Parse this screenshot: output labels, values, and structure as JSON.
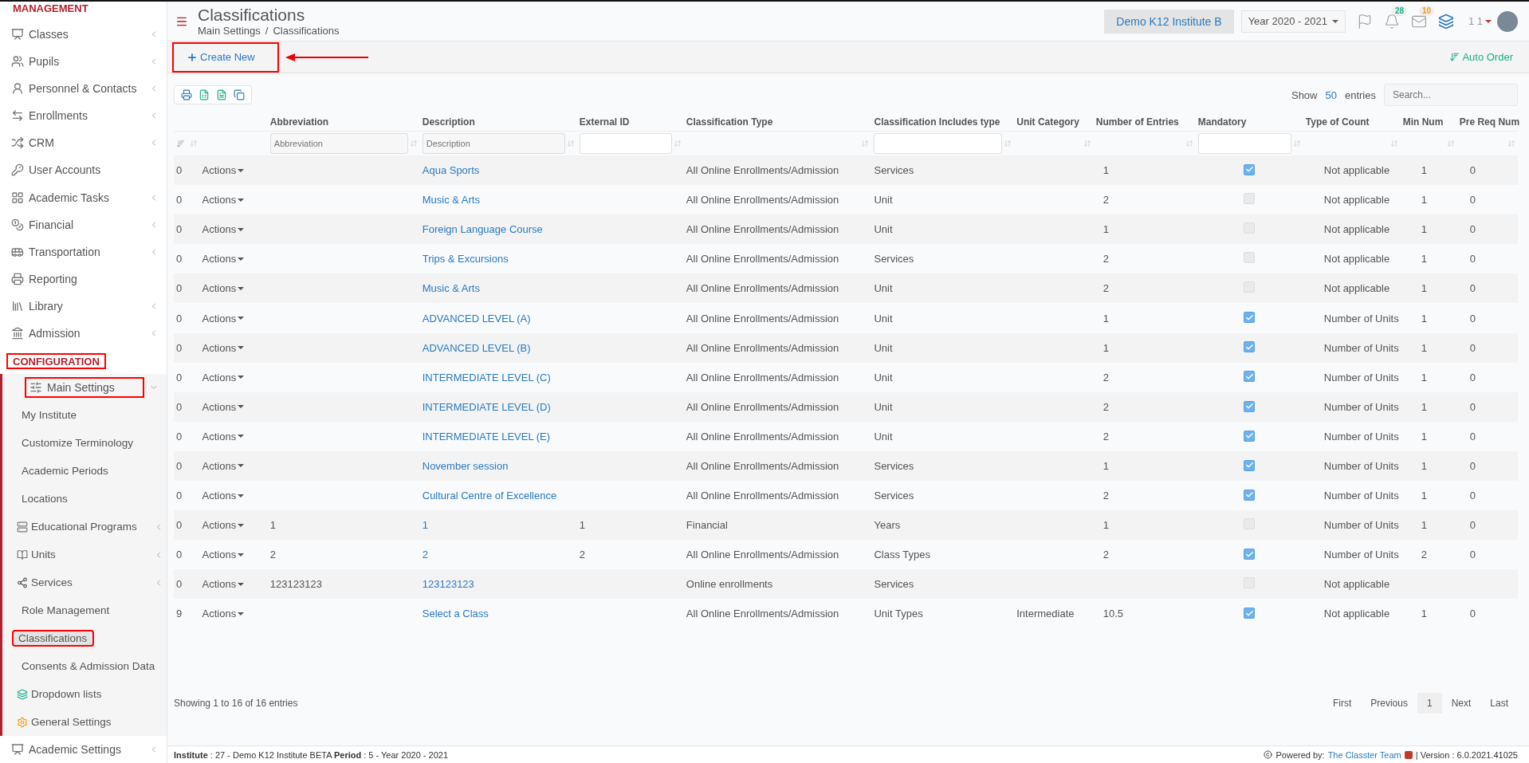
{
  "sidebar": {
    "sections": [
      {
        "title": "MANAGEMENT",
        "highlighted": false,
        "items": [
          {
            "label": "Classes",
            "collapsible": true,
            "expanded": false,
            "highlighted": false
          },
          {
            "label": "Pupils",
            "collapsible": true,
            "expanded": false,
            "highlighted": false
          },
          {
            "label": "Personnel & Contacts",
            "collapsible": true,
            "expanded": false,
            "highlighted": false
          },
          {
            "label": "Enrollments",
            "collapsible": true,
            "expanded": false,
            "highlighted": false
          },
          {
            "label": "CRM",
            "collapsible": true,
            "expanded": false,
            "highlighted": false
          },
          {
            "label": "User Accounts",
            "collapsible": false,
            "expanded": false,
            "highlighted": false
          },
          {
            "label": "Academic Tasks",
            "collapsible": true,
            "expanded": false,
            "highlighted": false
          },
          {
            "label": "Financial",
            "collapsible": true,
            "expanded": false,
            "highlighted": false
          },
          {
            "label": "Transportation",
            "collapsible": true,
            "expanded": false,
            "highlighted": false
          },
          {
            "label": "Reporting",
            "collapsible": false,
            "expanded": false,
            "highlighted": false
          },
          {
            "label": "Library",
            "collapsible": true,
            "expanded": false,
            "highlighted": false
          },
          {
            "label": "Admission",
            "collapsible": true,
            "expanded": false,
            "highlighted": false
          }
        ]
      },
      {
        "title": "CONFIGURATION",
        "highlighted": true,
        "items": [
          {
            "label": "Main Settings",
            "collapsible": true,
            "expanded": true,
            "highlighted": true,
            "children": [
              {
                "label": "My Institute",
                "collapsible": false,
                "selected": false,
                "highlighted": false
              },
              {
                "label": "Customize Terminology",
                "collapsible": false,
                "selected": false,
                "highlighted": false
              },
              {
                "label": "Academic Periods",
                "collapsible": false,
                "selected": false,
                "highlighted": false
              },
              {
                "label": "Locations",
                "collapsible": false,
                "selected": false,
                "highlighted": false
              },
              {
                "label": "Educational Programs",
                "collapsible": true,
                "selected": false,
                "highlighted": false
              },
              {
                "label": "Units",
                "collapsible": true,
                "selected": false,
                "highlighted": false
              },
              {
                "label": "Services",
                "collapsible": true,
                "selected": false,
                "highlighted": false
              },
              {
                "label": "Role Management",
                "collapsible": false,
                "selected": false,
                "highlighted": false
              },
              {
                "label": "Classifications",
                "collapsible": false,
                "selected": true,
                "highlighted": true
              },
              {
                "label": "Consents & Admission Data",
                "collapsible": false,
                "selected": false,
                "highlighted": false
              },
              {
                "label": "Dropdown lists",
                "collapsible": false,
                "selected": false,
                "highlighted": false
              },
              {
                "label": "General Settings",
                "collapsible": false,
                "selected": false,
                "highlighted": false
              }
            ]
          },
          {
            "label": "Academic Settings",
            "collapsible": true,
            "expanded": false,
            "highlighted": false
          }
        ]
      }
    ]
  },
  "header": {
    "title": "Classifications",
    "breadcrumb": [
      "Main Settings",
      "Classifications"
    ],
    "breadcrumb_separator": "/",
    "institute": "Demo K12 Institute B",
    "year": "Year 2020 - 2021",
    "notifications": "28",
    "messages": "10",
    "user": "1 1"
  },
  "toolbar": {
    "create_button": "Create New",
    "create_highlighted": true,
    "auto_order": "Auto Order"
  },
  "table_tools": {
    "show_label": "Show",
    "page_size": "50",
    "entries_label": "entries",
    "search_placeholder": "Search..."
  },
  "table": {
    "columns": [
      {
        "kind": "plain"
      },
      {
        "kind": "plain"
      },
      {
        "label": "Abbreviation",
        "kind": "textfilter",
        "placeholder": "Abbreviation"
      },
      {
        "label": "Description",
        "kind": "textfilter",
        "placeholder": "Description"
      },
      {
        "label": "External ID",
        "kind": "boxfilter"
      },
      {
        "label": "Classification Type",
        "kind": "plain"
      },
      {
        "label": "Classification Includes type",
        "kind": "boxfilter"
      },
      {
        "label": "Unit Category",
        "kind": "plain"
      },
      {
        "label": "Number of Entries",
        "kind": "plain"
      },
      {
        "label": "Mandatory",
        "kind": "boxfilter"
      },
      {
        "label": "Type of Count",
        "kind": "plain"
      },
      {
        "label": "Min Num",
        "kind": "plain"
      },
      {
        "label": "Pre Req Num",
        "kind": "plain"
      }
    ],
    "rows": [
      {
        "order": "0",
        "actions": "Actions",
        "abbreviation": "",
        "description": "Aqua Sports",
        "external_id": "",
        "type": "All Online Enrollments/Admission",
        "includes": "Services",
        "unit_category": "",
        "entries": "1",
        "mandatory": true,
        "count_type": "Not applicable",
        "min": "1",
        "prereq": "0"
      },
      {
        "order": "0",
        "actions": "Actions",
        "abbreviation": "",
        "description": "Music & Arts",
        "external_id": "",
        "type": "All Online Enrollments/Admission",
        "includes": "Unit",
        "unit_category": "",
        "entries": "2",
        "mandatory": false,
        "count_type": "Not applicable",
        "min": "1",
        "prereq": "0"
      },
      {
        "order": "0",
        "actions": "Actions",
        "abbreviation": "",
        "description": "Foreign Language Course",
        "external_id": "",
        "type": "All Online Enrollments/Admission",
        "includes": "Unit",
        "unit_category": "",
        "entries": "1",
        "mandatory": false,
        "count_type": "Not applicable",
        "min": "1",
        "prereq": "0"
      },
      {
        "order": "0",
        "actions": "Actions",
        "abbreviation": "",
        "description": "Trips & Excursions",
        "external_id": "",
        "type": "All Online Enrollments/Admission",
        "includes": "Services",
        "unit_category": "",
        "entries": "2",
        "mandatory": false,
        "count_type": "Not applicable",
        "min": "1",
        "prereq": "0"
      },
      {
        "order": "0",
        "actions": "Actions",
        "abbreviation": "",
        "description": "Music & Arts",
        "external_id": "",
        "type": "All Online Enrollments/Admission",
        "includes": "Unit",
        "unit_category": "",
        "entries": "2",
        "mandatory": false,
        "count_type": "Not applicable",
        "min": "1",
        "prereq": "0"
      },
      {
        "order": "0",
        "actions": "Actions",
        "abbreviation": "",
        "description": "ADVANCED LEVEL (A)",
        "external_id": "",
        "type": "All Online Enrollments/Admission",
        "includes": "Unit",
        "unit_category": "",
        "entries": "1",
        "mandatory": true,
        "count_type": "Number of Units",
        "min": "1",
        "prereq": "0"
      },
      {
        "order": "0",
        "actions": "Actions",
        "abbreviation": "",
        "description": "ADVANCED LEVEL (B)",
        "external_id": "",
        "type": "All Online Enrollments/Admission",
        "includes": "Unit",
        "unit_category": "",
        "entries": "1",
        "mandatory": true,
        "count_type": "Number of Units",
        "min": "1",
        "prereq": "0"
      },
      {
        "order": "0",
        "actions": "Actions",
        "abbreviation": "",
        "description": "INTERMEDIATE LEVEL (C)",
        "external_id": "",
        "type": "All Online Enrollments/Admission",
        "includes": "Unit",
        "unit_category": "",
        "entries": "2",
        "mandatory": true,
        "count_type": "Number of Units",
        "min": "1",
        "prereq": "0"
      },
      {
        "order": "0",
        "actions": "Actions",
        "abbreviation": "",
        "description": "INTERMEDIATE LEVEL (D)",
        "external_id": "",
        "type": "All Online Enrollments/Admission",
        "includes": "Unit",
        "unit_category": "",
        "entries": "2",
        "mandatory": true,
        "count_type": "Number of Units",
        "min": "1",
        "prereq": "0"
      },
      {
        "order": "0",
        "actions": "Actions",
        "abbreviation": "",
        "description": "INTERMEDIATE LEVEL (E)",
        "external_id": "",
        "type": "All Online Enrollments/Admission",
        "includes": "Unit",
        "unit_category": "",
        "entries": "2",
        "mandatory": true,
        "count_type": "Number of Units",
        "min": "1",
        "prereq": "0"
      },
      {
        "order": "0",
        "actions": "Actions",
        "abbreviation": "",
        "description": "November session",
        "external_id": "",
        "type": "All Online Enrollments/Admission",
        "includes": "Services",
        "unit_category": "",
        "entries": "1",
        "mandatory": true,
        "count_type": "Number of Units",
        "min": "1",
        "prereq": "0"
      },
      {
        "order": "0",
        "actions": "Actions",
        "abbreviation": "",
        "description": "Cultural Centre of Excellence",
        "external_id": "",
        "type": "All Online Enrollments/Admission",
        "includes": "Services",
        "unit_category": "",
        "entries": "2",
        "mandatory": true,
        "count_type": "Number of Units",
        "min": "1",
        "prereq": "0"
      },
      {
        "order": "0",
        "actions": "Actions",
        "abbreviation": "1",
        "description": "1",
        "external_id": "1",
        "type": "Financial",
        "includes": "Years",
        "unit_category": "",
        "entries": "1",
        "mandatory": false,
        "count_type": "Number of Units",
        "min": "1",
        "prereq": "0"
      },
      {
        "order": "0",
        "actions": "Actions",
        "abbreviation": "2",
        "description": "2",
        "external_id": "2",
        "type": "All Online Enrollments/Admission",
        "includes": "Class Types",
        "unit_category": "",
        "entries": "2",
        "mandatory": true,
        "count_type": "Number of Units",
        "min": "2",
        "prereq": "0"
      },
      {
        "order": "0",
        "actions": "Actions",
        "abbreviation": "123123123",
        "description": "123123123",
        "external_id": "",
        "type": "Online enrollments",
        "includes": "Services",
        "unit_category": "",
        "entries": "",
        "mandatory": false,
        "count_type": "Not applicable",
        "min": "",
        "prereq": ""
      },
      {
        "order": "9",
        "actions": "Actions",
        "abbreviation": "",
        "description": "Select a Class",
        "external_id": "",
        "type": "All Online Enrollments/Admission",
        "includes": "Unit Types",
        "unit_category": "Intermediate",
        "entries": "10.5",
        "mandatory": true,
        "count_type": "Not applicable",
        "min": "1",
        "prereq": "0"
      }
    ]
  },
  "table_info": "Showing 1 to 16 of 16 entries",
  "pagination": [
    {
      "label": "First",
      "selected": false
    },
    {
      "label": "Previous",
      "selected": false
    },
    {
      "label": "1",
      "selected": true
    },
    {
      "label": "Next",
      "selected": false
    },
    {
      "label": "Last",
      "selected": false
    }
  ],
  "footer": {
    "info": "**Institute** : 27 - Demo K12 Institute BETA **Period** : 5 - Year 2020 - 2021",
    "powered_label": "Powered by:",
    "powered_link": "The Classter Team",
    "version": "| Version : 6.0.2021.41025"
  }
}
